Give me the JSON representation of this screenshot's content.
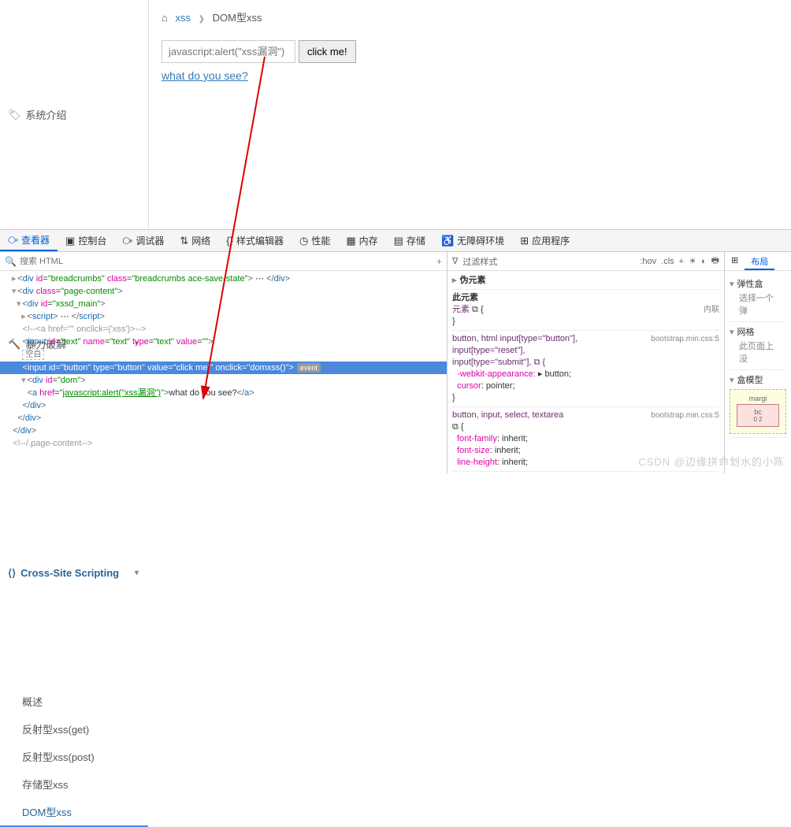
{
  "sidebar": {
    "intro": "系统介绍",
    "brute": "暴力破解",
    "xss": "Cross-Site Scripting",
    "subs": [
      "概述",
      "反射型xss(get)",
      "反射型xss(post)",
      "存储型xss",
      "DOM型xss"
    ]
  },
  "breadcrumb": {
    "home_link": "xss",
    "current": "DOM型xss"
  },
  "form": {
    "placeholder": "javascript:alert(\"xss漏洞\")",
    "button": "click me!",
    "link": "what do you see?"
  },
  "devtabs": [
    "查看器",
    "控制台",
    "调试器",
    "网络",
    "样式编辑器",
    "性能",
    "内存",
    "存储",
    "无障碍环境",
    "应用程序"
  ],
  "search_ph": "搜索 HTML",
  "tree": {
    "l1": "<div id=\"breadcrumbs\" class=\"breadcrumbs ace-save-state\"> ⋯ </div>",
    "l2": "<div class=\"page-content\">",
    "l3": "<div id=\"xssd_main\">",
    "l4": "<script> ⋯ </script>",
    "l5": "<!--<a href=\"\" onclick=('xss')>-->",
    "l6": "<input id=\"text\" name=\"text\" type=\"text\" value=\"\">",
    "l6b": "空白",
    "l7a": "<input id=\"button\" type=\"button\" value=\"click me!\" onclick=\"domxss()\">",
    "l7ev": "event",
    "l8": "<div id=\"dom\">",
    "l9a": "<a href=\"",
    "l9b": "javascript:alert(\"xss漏洞\")",
    "l9c": "\">what do you see?</a>",
    "l10": "</div>",
    "l11": "</div>",
    "l12": "</div>",
    "l13": "<!--/.page-content-->"
  },
  "styles": {
    "filter": "过滤样式",
    "hov": ":hov",
    "cls": ".cls",
    "pseudo": "伪元素",
    "this": "此元素",
    "elem": "元素",
    "inline": "内联",
    "rule1_sel": "button, html input[type=\"button\"],",
    "rule1_src": "bootstrap.min.css:5",
    "rule1_l2": "input[type=\"reset\"],",
    "rule1_l3": "input[type=\"submit\"], ⧉ {",
    "p1": "-webkit-appearance",
    "v1": "button",
    "p2": "cursor",
    "v2": "pointer",
    "rule2_sel": "button, input, select, textarea",
    "rule2_src": "bootstrap.min.css:5",
    "p3": "font-family",
    "v3": "inherit",
    "p4": "font-size",
    "v4": "inherit",
    "p5": "line-height",
    "v5": "inherit"
  },
  "layout": {
    "tabs": [
      "布局"
    ],
    "flex": "弹性盒",
    "flex_txt": "选择一个弹",
    "grid": "网格",
    "grid_txt": "此页面上没",
    "box": "盒模型",
    "margin": "margi",
    "bc": "bc",
    "dims": "0 2"
  },
  "watermark": "CSDN @边缘拼命划水的小陈"
}
